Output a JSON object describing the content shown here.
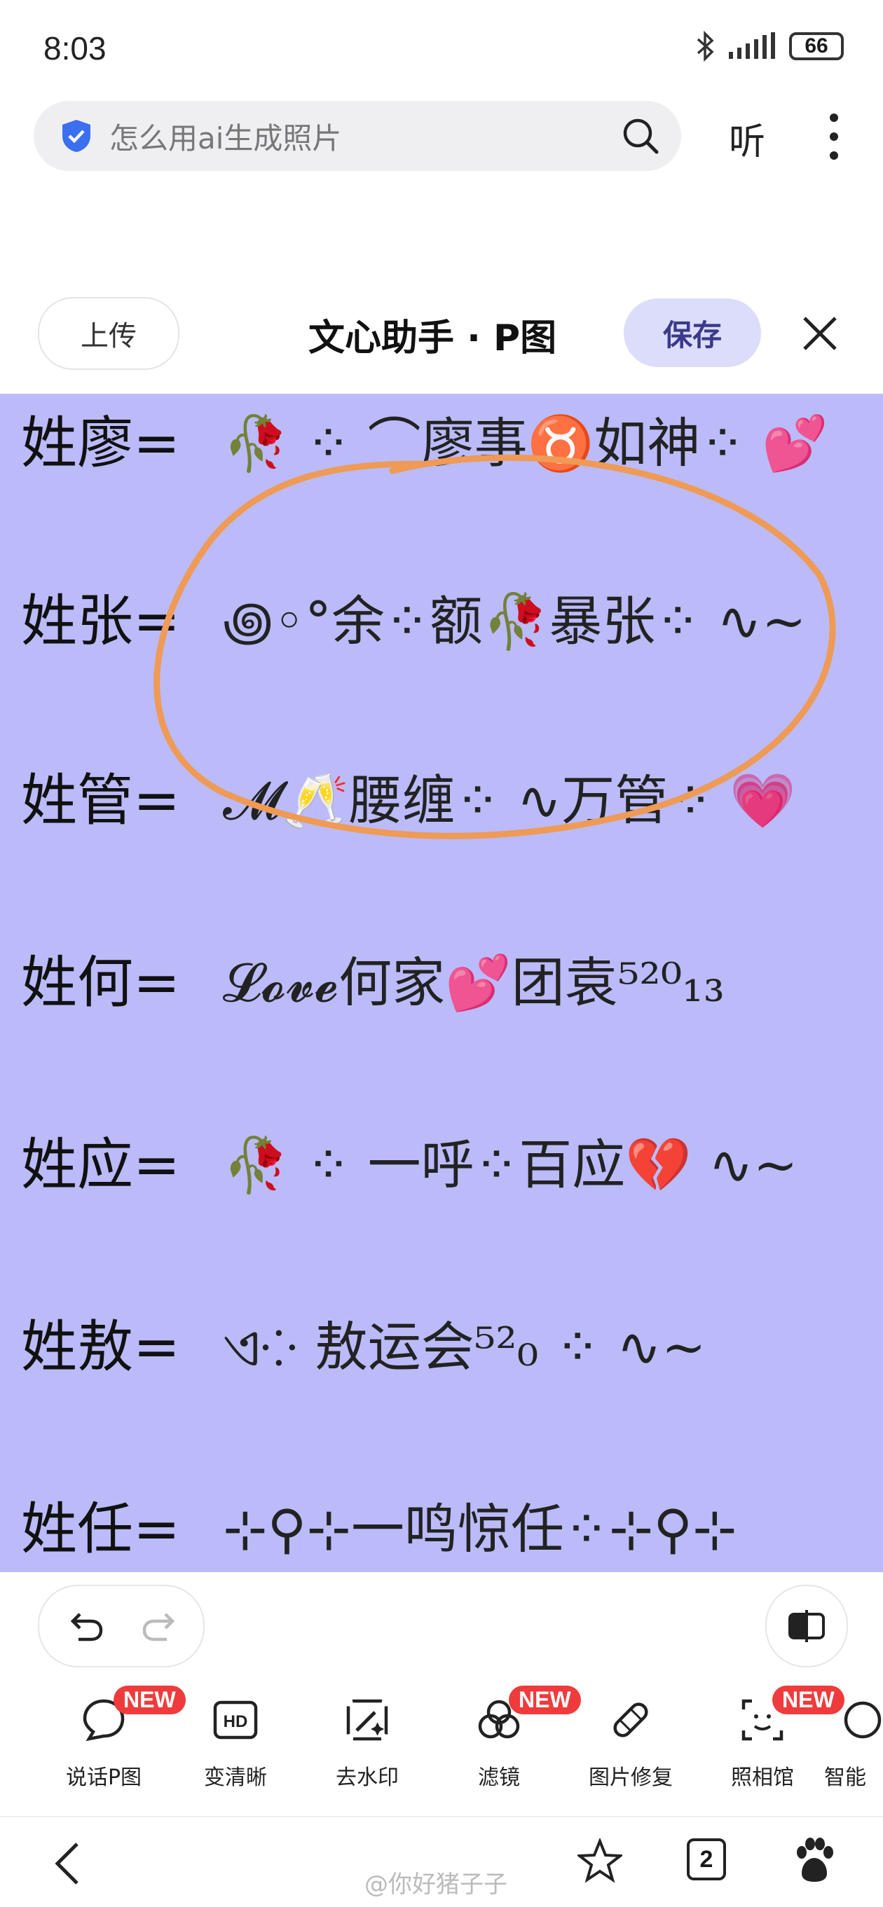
{
  "status": {
    "time": "8:03",
    "battery": "66"
  },
  "search": {
    "text": "怎么用ai生成照片",
    "listen_label": "听"
  },
  "editor": {
    "upload_label": "上传",
    "title": "文心助手 · P图",
    "save_label": "保存"
  },
  "rows": [
    {
      "surname": "姓廖=",
      "deco": "🥀 ⁘ ⌒廖事♉如神⁘ 💕"
    },
    {
      "surname": "姓张=",
      "deco": "꩜◦°余⁘额🥀暴张⁘ ∿~"
    },
    {
      "surname": "姓管=",
      "deco": "𝓜🥂腰缠⁘ ∿万管⁘ 💗"
    },
    {
      "surname": "姓何=",
      "deco": "𝓛𝓸𝓿𝓮何家💕团袁⁵²⁰₁₃"
    },
    {
      "surname": "姓应=",
      "deco": "🥀 ⁘ 一呼⁘百应💔 ∿~"
    },
    {
      "surname": "姓敖=",
      "deco": "ଏ⁘ 敖运会⁵²₀ ⁘ ∿~"
    },
    {
      "surname": "姓任=",
      "deco": "⊹⚲⊹一鸣惊任⁘⊹⚲⊹"
    }
  ],
  "tools": [
    {
      "label": "说话P图",
      "badge": "NEW",
      "icon": "speech-bubble-icon"
    },
    {
      "label": "变清晰",
      "badge": "",
      "icon": "hd-icon"
    },
    {
      "label": "去水印",
      "badge": "",
      "icon": "magic-wand-icon"
    },
    {
      "label": "滤镜",
      "badge": "NEW",
      "icon": "filter-circles-icon"
    },
    {
      "label": "图片修复",
      "badge": "",
      "icon": "bandage-icon"
    },
    {
      "label": "照相馆",
      "badge": "NEW",
      "icon": "face-scan-icon"
    },
    {
      "label": "智能",
      "badge": "",
      "icon": "sparkle-icon"
    }
  ],
  "nav": {
    "tabs_count": "2"
  },
  "watermark": "@你好猪子子",
  "colors": {
    "canvas_bg": "#bbbbfa",
    "accent_save": "#dcdcfb",
    "badge_red": "#ef3b3b",
    "circle_orange": "#ef9a55"
  }
}
